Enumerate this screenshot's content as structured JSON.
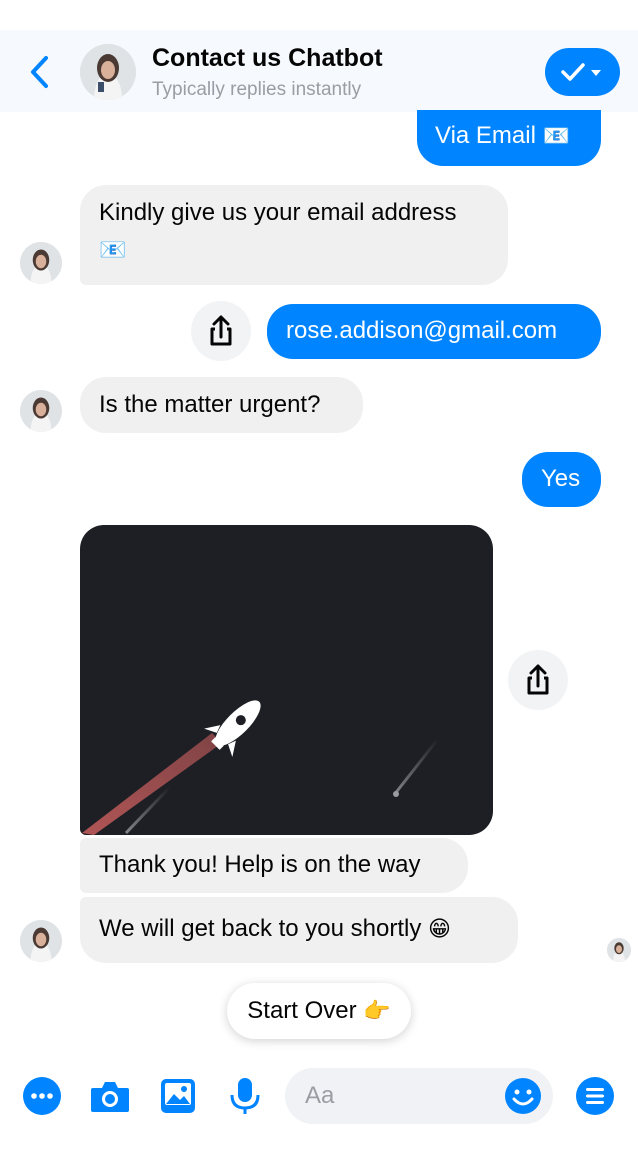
{
  "header": {
    "title": "Contact us Chatbot",
    "subtitle": "Typically replies instantly",
    "back_icon": "chevron-left-icon",
    "status_icon": "checkmark-dropdown-icon"
  },
  "messages": {
    "via_email": {
      "text": "Via Email",
      "emoji": "📧"
    },
    "ask_email": {
      "text": "Kindly give us your email address",
      "emoji": "📧"
    },
    "user_email": {
      "text": "rose.addison@gmail.com"
    },
    "ask_urgent": {
      "text": "Is the matter urgent?"
    },
    "yes": {
      "text": "Yes"
    },
    "thanks": {
      "text": "Thank you! Help is on the way"
    },
    "get_back": {
      "text": "We will get back to you shortly",
      "emoji": "😁"
    }
  },
  "quick_reply": {
    "label": "Start Over",
    "emoji": "👉"
  },
  "composer": {
    "placeholder": "Aa",
    "icons": [
      "more-icon",
      "camera-icon",
      "gallery-icon",
      "microphone-icon",
      "emoji-icon",
      "menu-icon"
    ]
  },
  "colors": {
    "accent": "#0084ff",
    "bubble_in": "#f0f0f0",
    "header_bg": "#f6f9fd",
    "gif_bg": "#1d1f24",
    "rocket_trail": "#c15b5b"
  }
}
